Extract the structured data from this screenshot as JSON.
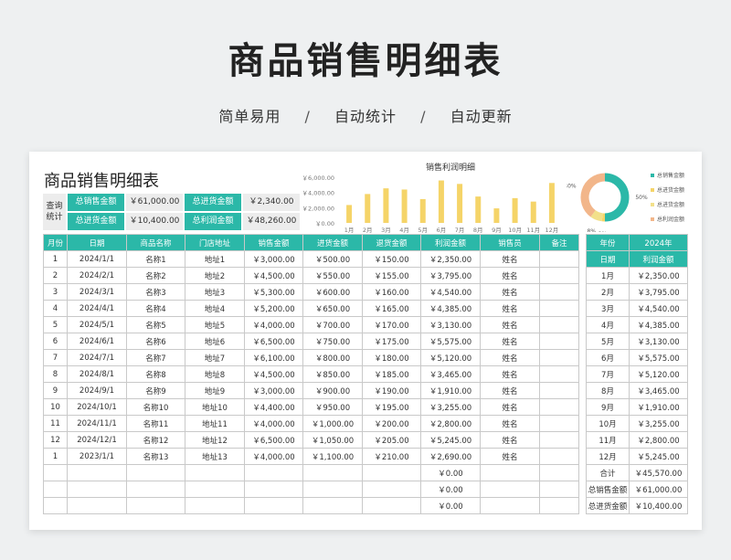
{
  "hero": {
    "title": "商品销售明细表",
    "tags": [
      "简单易用",
      "自动统计",
      "自动更新"
    ],
    "separator": "/"
  },
  "sheet": {
    "title": "商品销售明细表",
    "stats_label": "查询统计",
    "stats": [
      {
        "key": "总销售金额",
        "value": "￥61,000.00"
      },
      {
        "key": "总进货金额",
        "value": "￥2,340.00"
      },
      {
        "key": "总进货金额",
        "value": "￥10,400.00"
      },
      {
        "key": "总利润金额",
        "value": "￥48,260.00"
      }
    ]
  },
  "chart_data": [
    {
      "type": "bar",
      "title": "销售利润明细",
      "categories": [
        "1月",
        "2月",
        "3月",
        "4月",
        "5月",
        "6月",
        "7月",
        "8月",
        "9月",
        "10月",
        "11月",
        "12月"
      ],
      "values": [
        2350,
        3795,
        4540,
        4385,
        3130,
        5575,
        5120,
        3465,
        1910,
        3255,
        2800,
        5245
      ],
      "ylim": [
        0,
        6000
      ],
      "yticks": [
        "￥0.00",
        "￥2,000.00",
        "￥4,000.00",
        "￥6,000.00"
      ],
      "colors": {
        "bar": "#f5d468"
      },
      "grid": false
    },
    {
      "type": "pie",
      "labels": [
        "总销售金额",
        "总进货金额",
        "总进货金额",
        "总利润金额"
      ],
      "values": [
        50,
        2,
        8,
        40
      ],
      "value_labels": [
        "50%",
        "2%",
        "8%",
        "40%"
      ],
      "colors": [
        "#2bb8a8",
        "#f5d468",
        "#f2e08a",
        "#f2b68a"
      ],
      "legend": "right"
    }
  ],
  "table": {
    "headers": [
      "月份",
      "日期",
      "商品名称",
      "门店地址",
      "销售金额",
      "进货金额",
      "退货金额",
      "利润金额",
      "销售员",
      "备注"
    ],
    "rows": [
      [
        "1",
        "2024/1/1",
        "名称1",
        "地址1",
        "￥3,000.00",
        "￥500.00",
        "￥150.00",
        "￥2,350.00",
        "姓名",
        ""
      ],
      [
        "2",
        "2024/2/1",
        "名称2",
        "地址2",
        "￥4,500.00",
        "￥550.00",
        "￥155.00",
        "￥3,795.00",
        "姓名",
        ""
      ],
      [
        "3",
        "2024/3/1",
        "名称3",
        "地址3",
        "￥5,300.00",
        "￥600.00",
        "￥160.00",
        "￥4,540.00",
        "姓名",
        ""
      ],
      [
        "4",
        "2024/4/1",
        "名称4",
        "地址4",
        "￥5,200.00",
        "￥650.00",
        "￥165.00",
        "￥4,385.00",
        "姓名",
        ""
      ],
      [
        "5",
        "2024/5/1",
        "名称5",
        "地址5",
        "￥4,000.00",
        "￥700.00",
        "￥170.00",
        "￥3,130.00",
        "姓名",
        ""
      ],
      [
        "6",
        "2024/6/1",
        "名称6",
        "地址6",
        "￥6,500.00",
        "￥750.00",
        "￥175.00",
        "￥5,575.00",
        "姓名",
        ""
      ],
      [
        "7",
        "2024/7/1",
        "名称7",
        "地址7",
        "￥6,100.00",
        "￥800.00",
        "￥180.00",
        "￥5,120.00",
        "姓名",
        ""
      ],
      [
        "8",
        "2024/8/1",
        "名称8",
        "地址8",
        "￥4,500.00",
        "￥850.00",
        "￥185.00",
        "￥3,465.00",
        "姓名",
        ""
      ],
      [
        "9",
        "2024/9/1",
        "名称9",
        "地址9",
        "￥3,000.00",
        "￥900.00",
        "￥190.00",
        "￥1,910.00",
        "姓名",
        ""
      ],
      [
        "10",
        "2024/10/1",
        "名称10",
        "地址10",
        "￥4,400.00",
        "￥950.00",
        "￥195.00",
        "￥3,255.00",
        "姓名",
        ""
      ],
      [
        "11",
        "2024/11/1",
        "名称11",
        "地址11",
        "￥4,000.00",
        "￥1,000.00",
        "￥200.00",
        "￥2,800.00",
        "姓名",
        ""
      ],
      [
        "12",
        "2024/12/1",
        "名称12",
        "地址12",
        "￥6,500.00",
        "￥1,050.00",
        "￥205.00",
        "￥5,245.00",
        "姓名",
        ""
      ],
      [
        "1",
        "2023/1/1",
        "名称13",
        "地址13",
        "￥4,000.00",
        "￥1,100.00",
        "￥210.00",
        "￥2,690.00",
        "姓名",
        ""
      ],
      [
        "",
        "",
        "",
        "",
        "",
        "",
        "",
        "￥0.00",
        "",
        ""
      ],
      [
        "",
        "",
        "",
        "",
        "",
        "",
        "",
        "￥0.00",
        "",
        ""
      ],
      [
        "",
        "",
        "",
        "",
        "",
        "",
        "",
        "￥0.00",
        "",
        ""
      ]
    ]
  },
  "side": {
    "year_label": "年份",
    "year_value": "2024年",
    "date_label": "日期",
    "profit_label": "利润金额",
    "rows": [
      [
        "1月",
        "￥2,350.00"
      ],
      [
        "2月",
        "￥3,795.00"
      ],
      [
        "3月",
        "￥4,540.00"
      ],
      [
        "4月",
        "￥4,385.00"
      ],
      [
        "5月",
        "￥3,130.00"
      ],
      [
        "6月",
        "￥5,575.00"
      ],
      [
        "7月",
        "￥5,120.00"
      ],
      [
        "8月",
        "￥3,465.00"
      ],
      [
        "9月",
        "￥1,910.00"
      ],
      [
        "10月",
        "￥3,255.00"
      ],
      [
        "11月",
        "￥2,800.00"
      ],
      [
        "12月",
        "￥5,245.00"
      ],
      [
        "合计",
        "￥45,570.00"
      ],
      [
        "总销售金额",
        "￥61,000.00"
      ],
      [
        "总进货金额",
        "￥10,400.00"
      ]
    ]
  }
}
